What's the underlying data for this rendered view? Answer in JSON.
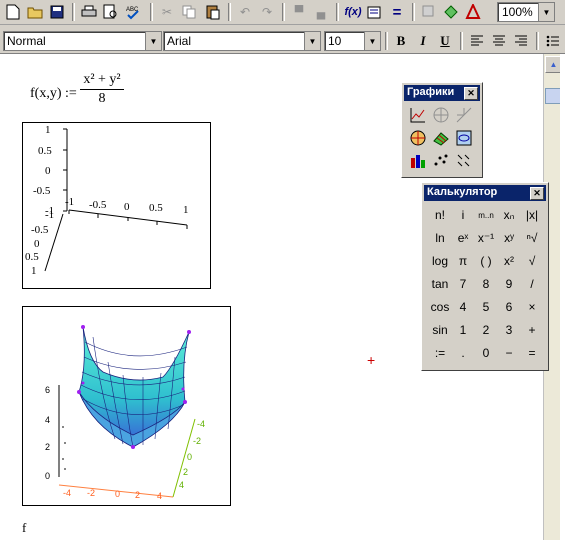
{
  "toolbar": {
    "zoom": "100%",
    "fx_label": "f(x)",
    "equals_label": "="
  },
  "format_bar": {
    "style": "Normal",
    "font": "Arial",
    "size": "10",
    "bold": "B",
    "italic": "I",
    "underline": "U"
  },
  "worksheet": {
    "formula_lhs": "f(x,y) :=",
    "formula_num": "x² + y²",
    "formula_den": "8",
    "f_text": "f"
  },
  "plot1": {
    "vertical_ticks": [
      "1",
      "0.5",
      "0",
      "-0.5",
      "-1"
    ],
    "depth_ticks": [
      "-1",
      "-0.5",
      "0",
      "0.5",
      "1"
    ],
    "horizontal_ticks": [
      "-1",
      "-0.5",
      "0",
      "0.5",
      "1"
    ]
  },
  "plot2": {
    "z_ticks": [
      "6",
      "4",
      "2",
      "0"
    ],
    "x_ticks": [
      "-4",
      "-2",
      "0",
      "2",
      "4"
    ],
    "y_ticks": [
      "-4",
      "-2",
      "0",
      "2",
      "4"
    ]
  },
  "graphs_panel": {
    "title": "Графики",
    "icons": [
      "xy-plot-icon",
      "polar-plot-icon",
      "zoom-icon",
      "polar-graph-icon",
      "surface-plot-icon",
      "contour-plot-icon",
      "3d-bar-plot-icon",
      "scatter-plot-icon",
      "vector-field-icon"
    ]
  },
  "calc_panel": {
    "title": "Калькулятор",
    "rows": [
      [
        "n!",
        "i",
        "m..n",
        "xₙ",
        "|x|"
      ],
      [
        "ln",
        "eˣ",
        "x⁻¹",
        "xʸ",
        "ⁿ√"
      ],
      [
        "log",
        "π",
        "( )",
        "x²",
        "√"
      ],
      [
        "tan",
        "7",
        "8",
        "9",
        "/"
      ],
      [
        "cos",
        "4",
        "5",
        "6",
        "×"
      ],
      [
        "sin",
        "1",
        "2",
        "3",
        "+"
      ],
      [
        ":=",
        ".",
        "0",
        "−",
        "="
      ]
    ]
  },
  "colors": {
    "title_bar": "#0a246a",
    "surface": "#40e0d0",
    "mesh": "#1a237e",
    "crosshair": "#cc0000"
  }
}
